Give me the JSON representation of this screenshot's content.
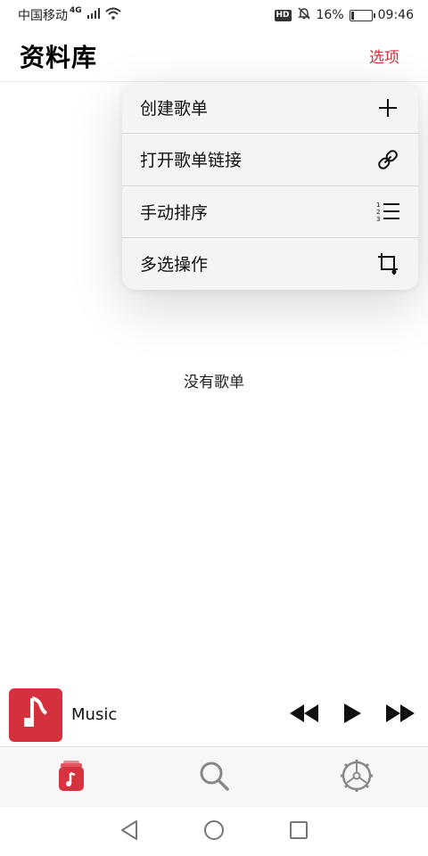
{
  "status_bar": {
    "carrier": "中国移动",
    "network": "4G",
    "hd": "HD",
    "battery_percent": "16%",
    "battery_level": 0.16,
    "time": "09:46"
  },
  "header": {
    "title": "资料库",
    "options_label": "选项"
  },
  "dropdown": {
    "items": [
      {
        "label": "创建歌单",
        "icon": "plus-icon"
      },
      {
        "label": "打开歌单链接",
        "icon": "link-icon"
      },
      {
        "label": "手动排序",
        "icon": "numbered-list-icon"
      },
      {
        "label": "多选操作",
        "icon": "crop-icon"
      }
    ]
  },
  "empty_state": {
    "text": "没有歌单"
  },
  "mini_player": {
    "title": "Music",
    "artwork_color": "#d5313c",
    "controls": [
      "rewind-icon",
      "play-icon",
      "fast-forward-icon"
    ]
  },
  "tabs": [
    {
      "name": "library",
      "icon": "library-icon",
      "active": true
    },
    {
      "name": "search",
      "icon": "search-icon",
      "active": false
    },
    {
      "name": "settings",
      "icon": "settings-icon",
      "active": false
    }
  ],
  "colors": {
    "accent": "#d6323f"
  }
}
